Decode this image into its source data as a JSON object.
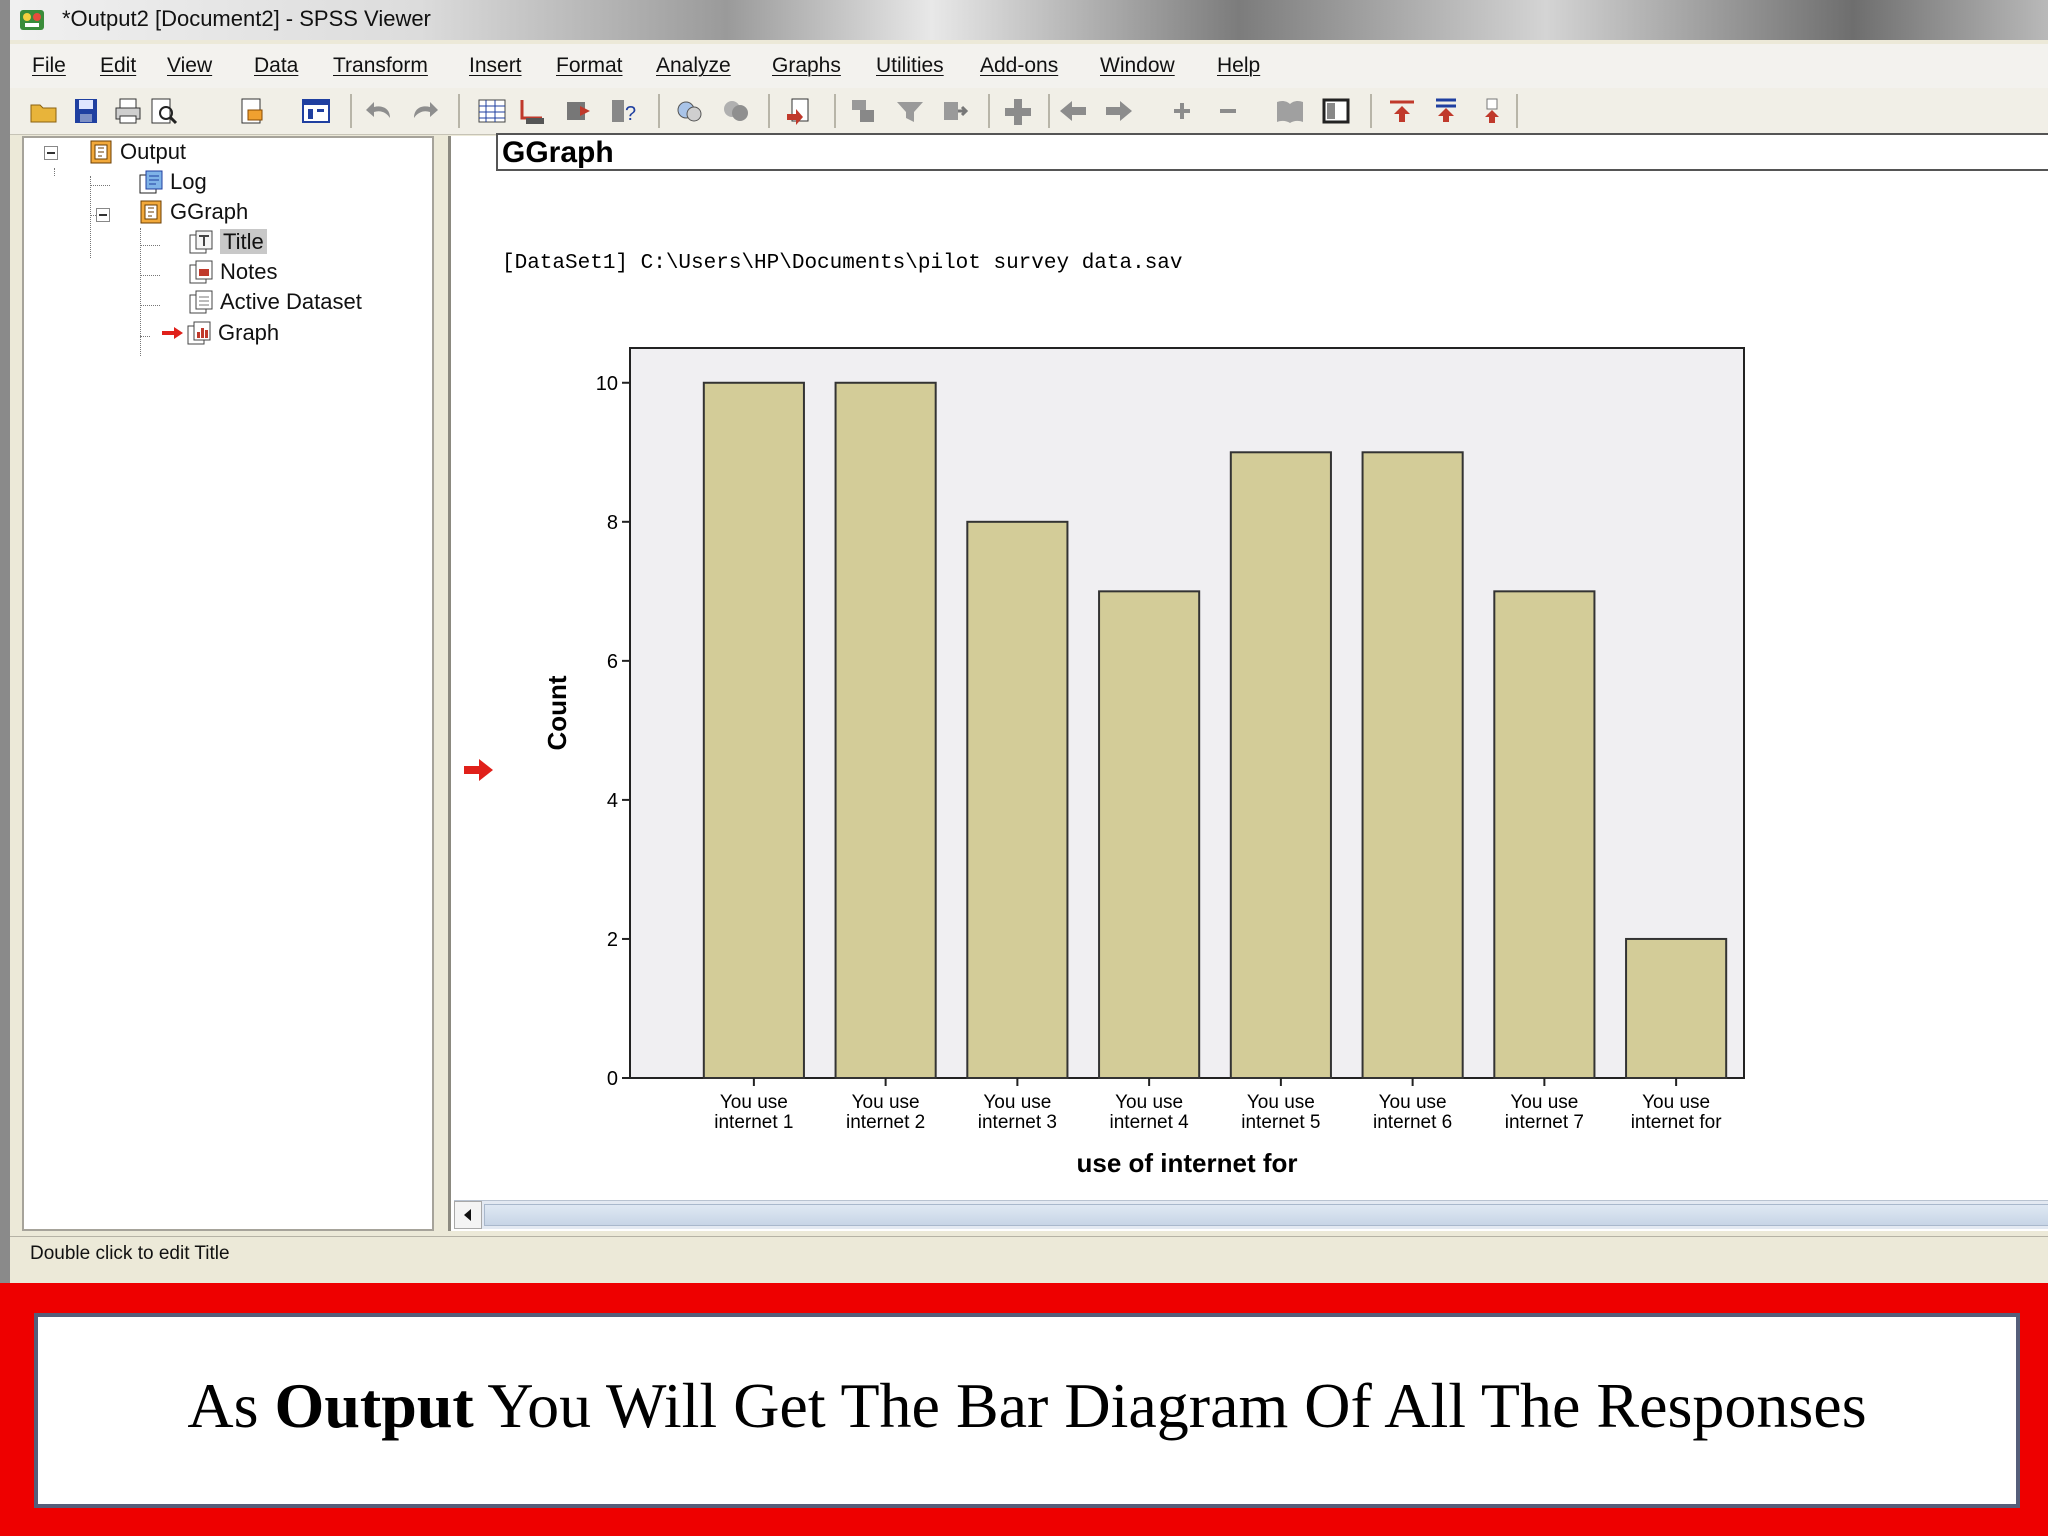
{
  "window": {
    "title": "*Output2 [Document2] - SPSS Viewer"
  },
  "menu": {
    "items": [
      "File",
      "Edit",
      "View",
      "Data",
      "Transform",
      "Insert",
      "Format",
      "Analyze",
      "Graphs",
      "Utilities",
      "Add-ons",
      "Window",
      "Help"
    ]
  },
  "toolbar": {
    "icons": [
      "open-icon",
      "save-icon",
      "print-icon",
      "print-preview-icon",
      "export-icon",
      "recall-dialog-icon",
      "undo-icon",
      "redo-icon",
      "goto-data-icon",
      "goto-case-icon",
      "goto-variable-icon",
      "variables-icon",
      "pivot-icon",
      "show-all-icon",
      "designate-window-icon",
      "insert-heading-icon",
      "insert-title-icon",
      "insert-text-icon",
      "insert-output-icon",
      "promote-icon",
      "demote-icon",
      "expand-icon",
      "collapse-icon",
      "show-icon",
      "hide-icon",
      "select-last-output-icon",
      "bookmark-icon"
    ]
  },
  "tree": {
    "items": [
      {
        "label": "Output"
      },
      {
        "label": "Log"
      },
      {
        "label": "GGraph"
      },
      {
        "label": "Title"
      },
      {
        "label": "Notes"
      },
      {
        "label": "Active Dataset"
      },
      {
        "label": "Graph"
      }
    ]
  },
  "output": {
    "heading": "GGraph",
    "dataset_line": "[DataSet1] C:\\Users\\HP\\Documents\\pilot survey data.sav"
  },
  "status": {
    "text": "Double click to edit Title"
  },
  "caption": {
    "before": "As ",
    "bold": "Output",
    "after": " You Will Get The Bar Diagram Of All The Responses"
  },
  "colors": {
    "bar_fill": "#d3cc98",
    "plot_bg": "#f0eff2",
    "caption_border": "#ee0000",
    "pointer_arrow": "#e0201a"
  },
  "chart_data": {
    "type": "bar",
    "categories": [
      [
        "You use",
        "internet 1"
      ],
      [
        "You use",
        "internet 2"
      ],
      [
        "You use",
        "internet 3"
      ],
      [
        "You use",
        "internet 4"
      ],
      [
        "You use",
        "internet 5"
      ],
      [
        "You use",
        "internet 6"
      ],
      [
        "You use",
        "internet 7"
      ],
      [
        "You use",
        "internet for"
      ]
    ],
    "values": [
      10,
      10,
      8,
      7,
      9,
      9,
      7,
      2
    ],
    "xlabel": "use of internet for",
    "ylabel": "Count",
    "ylim": [
      0,
      10.5
    ],
    "yticks": [
      0,
      2,
      4,
      6,
      8,
      10
    ],
    "grid": false,
    "legend": "none"
  }
}
